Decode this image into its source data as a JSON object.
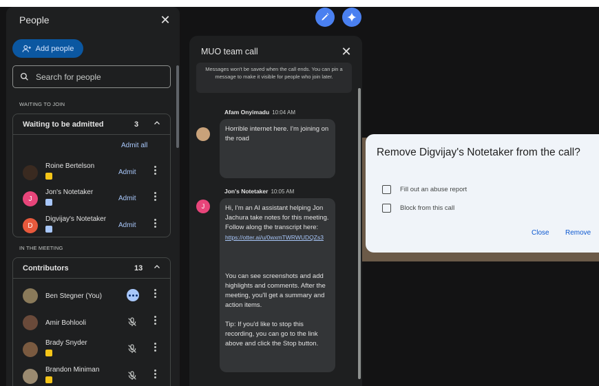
{
  "people_panel": {
    "title": "People",
    "add_button": "Add people",
    "search_placeholder": "Search for people",
    "waiting_section": "WAITING TO JOIN",
    "waiting_group": {
      "title": "Waiting to be admitted",
      "count": "3",
      "admit_all": "Admit all"
    },
    "waiting": [
      {
        "name": "Roine Bertelson",
        "action": "Admit",
        "avatar_color": "#3a2a20",
        "initial": "",
        "badge_color": "#f5c518"
      },
      {
        "name": "Jon's Notetaker",
        "action": "Admit",
        "avatar_color": "#e8457a",
        "initial": "J",
        "badge_color": "#a8c7fa"
      },
      {
        "name": "Digvijay's Notetaker",
        "action": "Admit",
        "avatar_color": "#e8593c",
        "initial": "D",
        "badge_color": "#a8c7fa"
      }
    ],
    "meeting_section": "IN THE MEETING",
    "contributors_group": {
      "title": "Contributors",
      "count": "13"
    },
    "contributors": [
      {
        "name": "Ben Stegner (You)",
        "avatar_color": "#8a7a5a",
        "status": "more"
      },
      {
        "name": "Amir Bohlooli",
        "avatar_color": "#6a4a3a",
        "status": "muted"
      },
      {
        "name": "Brady Snyder",
        "avatar_color": "#7a5a40",
        "status": "muted",
        "badge_color": "#f5c518"
      },
      {
        "name": "Brandon Miniman",
        "avatar_color": "#9a8a70",
        "status": "muted",
        "badge_color": "#f5c518"
      }
    ]
  },
  "chat": {
    "title": "MUO team call",
    "notice": "Messages won't be saved when the call ends. You can pin a message to make it visible for people who join later.",
    "messages": [
      {
        "author": "Afam Onyimadu",
        "time": "10:04 AM",
        "text": "Horrible internet here. I'm joining on the road"
      },
      {
        "author": "Jon's Notetaker",
        "time": "10:05 AM",
        "text1": "Hi, I'm an AI assistant helping Jon Jachura take notes for this meeting. Follow along the transcript here:",
        "link": "https://otter.ai/u/0wxmTWRWUDQZs3",
        "text2": "You can see screenshots and add highlights and comments. After the meeting, you'll get a summary and action items.",
        "text3": "Tip: If you'd like to stop this recording, you can go to the link above and click the Stop button."
      }
    ]
  },
  "dialog": {
    "title": "Remove Digvijay's Notetaker from the call?",
    "options": [
      "Fill out an abuse report",
      "Block from this call"
    ],
    "close": "Close",
    "remove": "Remove"
  },
  "colors": {
    "accent": "#a8c7fa",
    "primary_button": "#0b57a1",
    "panel": "#1e1f20",
    "background": "#131314"
  }
}
